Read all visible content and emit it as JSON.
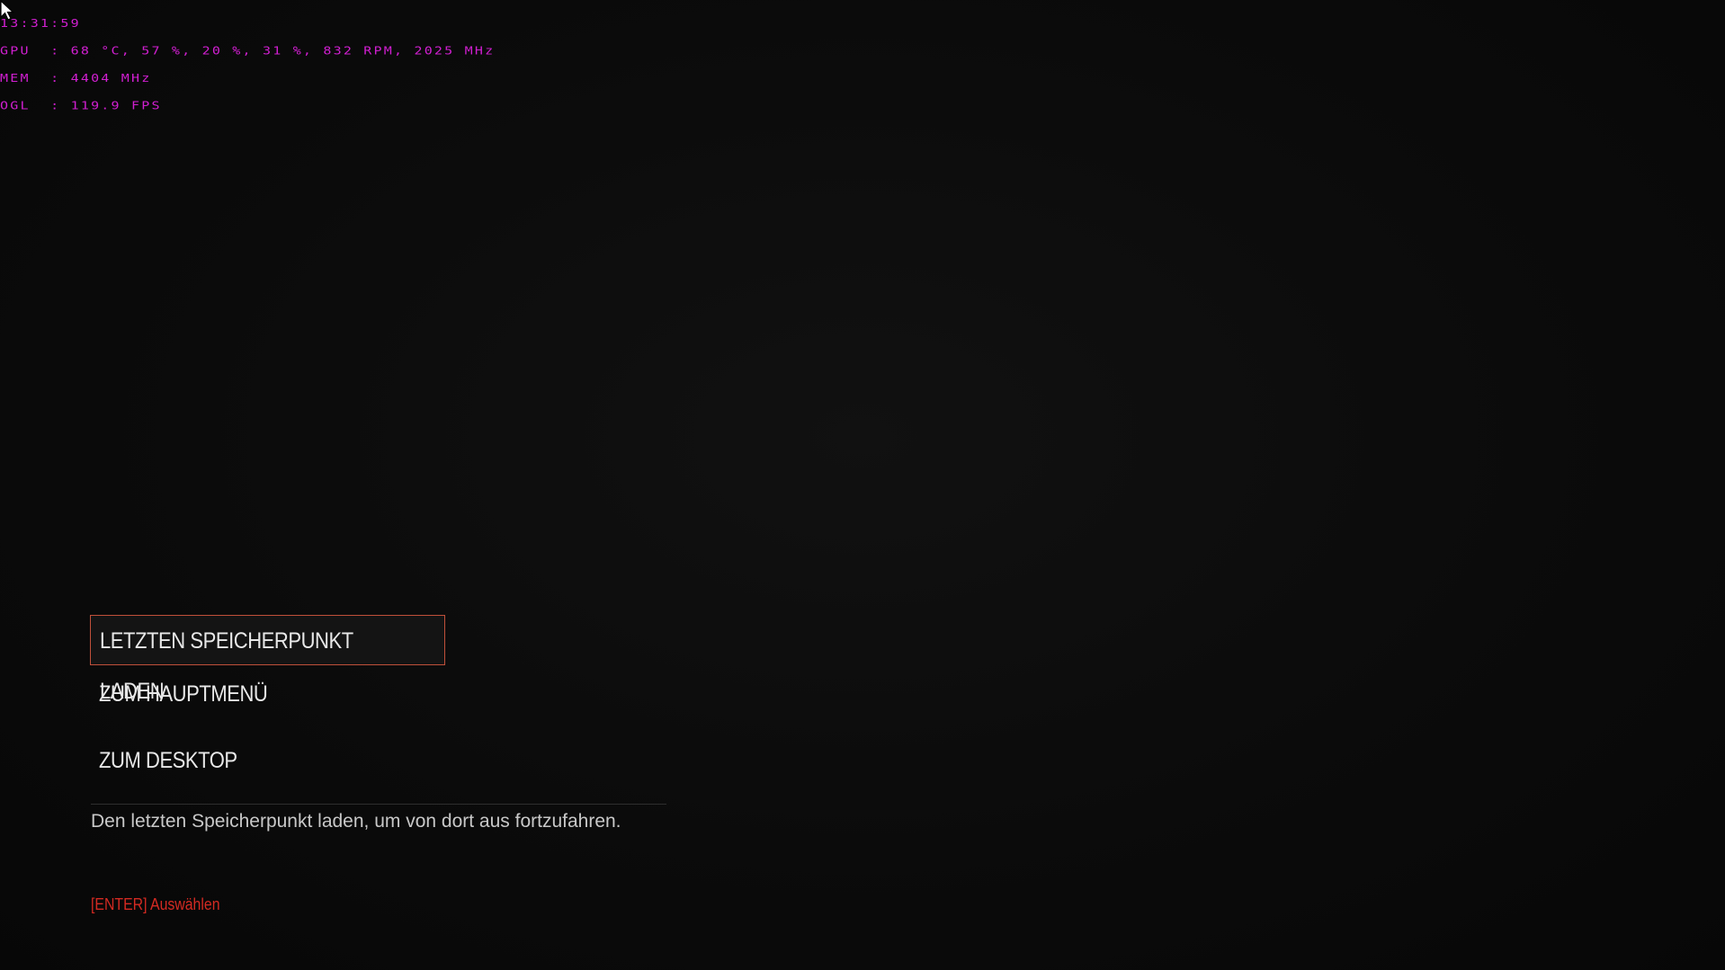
{
  "osd": {
    "clock": "13:31:59",
    "gpu_line": "GPU  : 68 °C, 57 %, 20 %, 31 %, 832 RPM, 2025 MHz",
    "mem_line": "MEM  : 4404 MHz",
    "ogl_line": "OGL  : 119.9 FPS",
    "color": "#d21fd2"
  },
  "menu": {
    "items": [
      {
        "label": "LETZTEN SPEICHERPUNKT LADEN",
        "selected": true
      },
      {
        "label": "ZUM HAUPTMENÜ",
        "selected": false
      },
      {
        "label": "ZUM DESKTOP",
        "selected": false
      }
    ],
    "selection_border_color": "#c0503a"
  },
  "description": "Den letzten Speicherpunkt laden, um von dort aus fortzufahren.",
  "hint": {
    "text": "[ENTER] Auswählen",
    "color": "#d42a22"
  },
  "cursor": {
    "icon": "mouse-pointer-icon"
  }
}
